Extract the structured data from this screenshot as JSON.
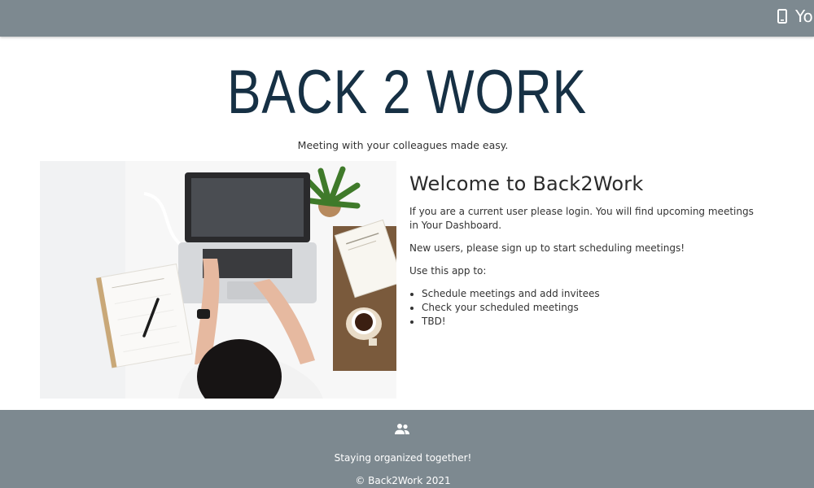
{
  "header": {
    "nav_label": "Yo",
    "nav_icon": "phone-icon",
    "background_color": "#7d8990"
  },
  "hero": {
    "title": "BACK 2 WORK",
    "tagline": "Meeting with your colleagues made easy.",
    "title_color": "#163044"
  },
  "main": {
    "heading": "Welcome to Back2Work",
    "paragraphs": [
      "If you are a current user please login. You will find upcoming meetings in Your Dashboard.",
      "New users, please sign up to start scheduling meetings!",
      "Use this app to:"
    ],
    "features": [
      "Schedule meetings and add invitees",
      "Check your scheduled meetings",
      "TBD!"
    ]
  },
  "footer": {
    "icon": "group-icon",
    "slogan": "Staying organized together!",
    "copyright": "© Back2Work 2021"
  }
}
